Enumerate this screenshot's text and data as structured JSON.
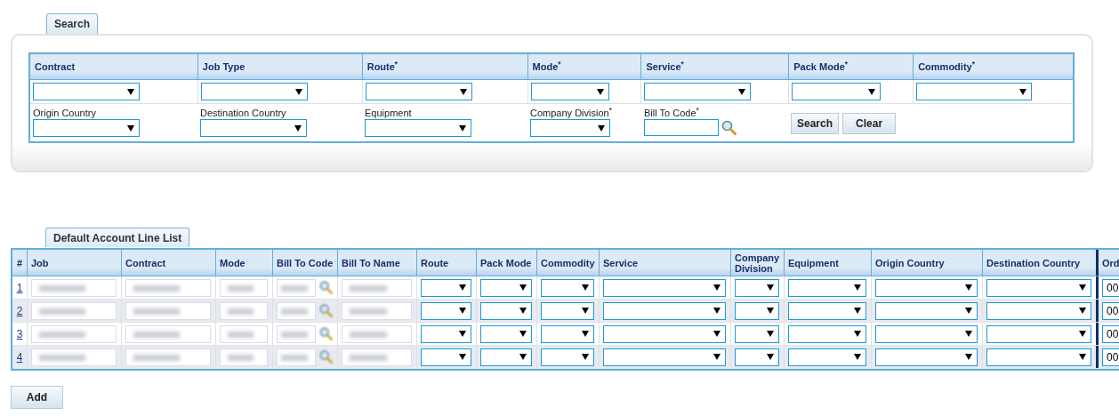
{
  "search": {
    "tab": "Search",
    "top_fields": [
      {
        "label": "Contract"
      },
      {
        "label": "Job Type"
      },
      {
        "label": "Route$^{*}$"
      },
      {
        "label": "Mode$^{*}$"
      },
      {
        "label": "Service$^{*}$"
      },
      {
        "label": "Pack Mode$^{*}$"
      },
      {
        "label": "Commodity$^{*}$"
      }
    ],
    "bottom_fields": [
      {
        "label": "Origin Country",
        "kind": "select"
      },
      {
        "label": "Destination Country",
        "kind": "select"
      },
      {
        "label": "Equipment",
        "kind": "select"
      },
      {
        "label": "Company Division$^{*}$",
        "kind": "select"
      },
      {
        "label": "Bill To Code$^{*}$",
        "kind": "lookup"
      }
    ],
    "buttons": [
      "Search",
      "Clear"
    ]
  },
  "list": {
    "tab": "Default Account Line List",
    "columns": [
      {
        "label": "#",
        "kind": "index"
      },
      {
        "label": "Job",
        "kind": "blurred"
      },
      {
        "label": "Contract",
        "kind": "blurred"
      },
      {
        "label": "Mode",
        "kind": "blurred"
      },
      {
        "label": "Bill To Code",
        "kind": "lookup"
      },
      {
        "label": "Bill To Name",
        "kind": "blurred"
      },
      {
        "label": "Route",
        "kind": "select"
      },
      {
        "label": "Pack Mode",
        "kind": "select"
      },
      {
        "label": "Commodity",
        "kind": "select"
      },
      {
        "label": "Service",
        "kind": "select"
      },
      {
        "label": "Company Division",
        "kind": "select"
      },
      {
        "label": "Equipment",
        "kind": "select"
      },
      {
        "label": "Origin Country",
        "kind": "select"
      },
      {
        "label": "Destination Country",
        "kind": "select"
      },
      {
        "label": "Ord",
        "kind": "text"
      }
    ],
    "rows": [
      {
        "number": "1",
        "ord": "00"
      },
      {
        "number": "2",
        "ord": "00"
      },
      {
        "number": "3",
        "ord": "00"
      },
      {
        "number": "4",
        "ord": "00"
      }
    ],
    "add_button": "Add"
  }
}
